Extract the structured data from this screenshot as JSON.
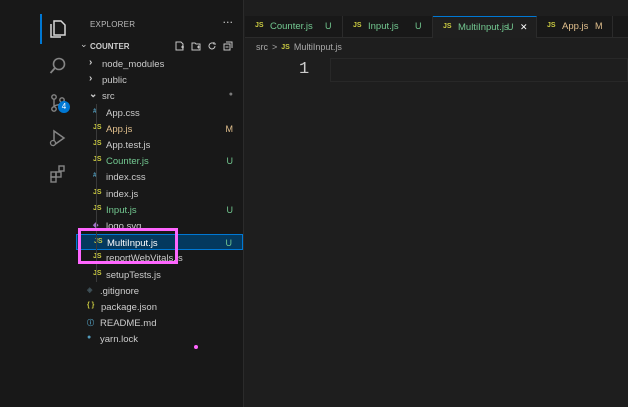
{
  "activity_bar": {
    "icons": [
      "explorer-icon",
      "search-icon",
      "source-control-icon",
      "run-debug-icon",
      "extensions-icon"
    ],
    "scm_badge": "4",
    "accent": "#0078d4"
  },
  "sidebar": {
    "title": "EXPLORER",
    "more": "···",
    "section": "COUNTER",
    "tree": [
      {
        "label": "node_modules",
        "type": "folder",
        "status": ""
      },
      {
        "label": "public",
        "type": "folder",
        "status": ""
      },
      {
        "label": "src",
        "type": "folder-open",
        "status": "●"
      },
      {
        "label": "App.css",
        "type": "css",
        "status": ""
      },
      {
        "label": "App.js",
        "type": "js",
        "status": "M"
      },
      {
        "label": "App.test.js",
        "type": "js",
        "status": ""
      },
      {
        "label": "Counter.js",
        "type": "js",
        "status": "U"
      },
      {
        "label": "index.css",
        "type": "css",
        "status": ""
      },
      {
        "label": "index.js",
        "type": "js",
        "status": ""
      },
      {
        "label": "Input.js",
        "type": "js",
        "status": "U"
      },
      {
        "label": "logo.svg",
        "type": "svg",
        "status": ""
      },
      {
        "label": "MultiInput.js",
        "type": "js",
        "status": "U"
      },
      {
        "label": "reportWebVitals.js",
        "type": "js",
        "status": ""
      },
      {
        "label": "setupTests.js",
        "type": "js",
        "status": ""
      },
      {
        "label": ".gitignore",
        "type": "git",
        "status": ""
      },
      {
        "label": "package.json",
        "type": "json",
        "status": ""
      },
      {
        "label": "README.md",
        "type": "info",
        "status": ""
      },
      {
        "label": "yarn.lock",
        "type": "yarn",
        "status": ""
      }
    ]
  },
  "tabs": [
    {
      "label": "Counter.js",
      "status": "U",
      "icon": "JS"
    },
    {
      "label": "Input.js",
      "status": "U",
      "icon": "JS"
    },
    {
      "label": "MultiInput.js",
      "status": "U",
      "icon": "JS",
      "close": "✕"
    },
    {
      "label": "App.js",
      "status": "M",
      "icon": "JS"
    }
  ],
  "breadcrumb": {
    "folder": "src",
    "separator": ">",
    "file_icon": "JS",
    "file": "MultiInput.js"
  },
  "editor": {
    "line_number": "1"
  },
  "colors": {
    "untracked": "#73c991",
    "modified": "#e2c08d",
    "js": "#cbcb41",
    "css": "#519aba",
    "highlight": "#ff66ff"
  }
}
